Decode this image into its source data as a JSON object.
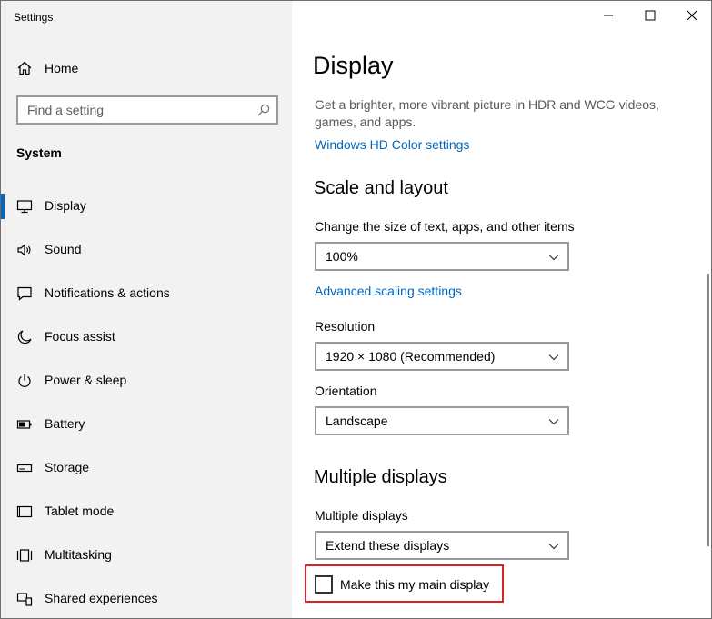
{
  "app": {
    "title": "Settings"
  },
  "sidebar": {
    "home_label": "Home",
    "search_placeholder": "Find a setting",
    "section": "System",
    "items": [
      {
        "label": "Display",
        "icon": "monitor-icon",
        "active": true
      },
      {
        "label": "Sound",
        "icon": "speaker-icon"
      },
      {
        "label": "Notifications & actions",
        "icon": "notification-icon"
      },
      {
        "label": "Focus assist",
        "icon": "moon-icon"
      },
      {
        "label": "Power & sleep",
        "icon": "power-icon"
      },
      {
        "label": "Battery",
        "icon": "battery-icon"
      },
      {
        "label": "Storage",
        "icon": "storage-icon"
      },
      {
        "label": "Tablet mode",
        "icon": "tablet-icon"
      },
      {
        "label": "Multitasking",
        "icon": "multitasking-icon"
      },
      {
        "label": "Shared experiences",
        "icon": "shared-experiences-icon"
      }
    ]
  },
  "main": {
    "title": "Display",
    "hdr_description": "Get a brighter, more vibrant picture in HDR and WCG videos, games, and apps.",
    "hdr_link": "Windows HD Color settings",
    "scale_heading": "Scale and layout",
    "scale_label": "Change the size of text, apps, and other items",
    "scale_value": "100%",
    "advanced_link": "Advanced scaling settings",
    "resolution_label": "Resolution",
    "resolution_value": "1920 × 1080 (Recommended)",
    "orientation_label": "Orientation",
    "orientation_value": "Landscape",
    "multi_heading": "Multiple displays",
    "multi_label": "Multiple displays",
    "multi_value": "Extend these displays",
    "main_display_checkbox": "Make this my main display",
    "main_display_checked": false
  },
  "colors": {
    "accent": "#0067c0",
    "highlight": "#e02020",
    "sidebar_bg": "#f2f2f2"
  }
}
